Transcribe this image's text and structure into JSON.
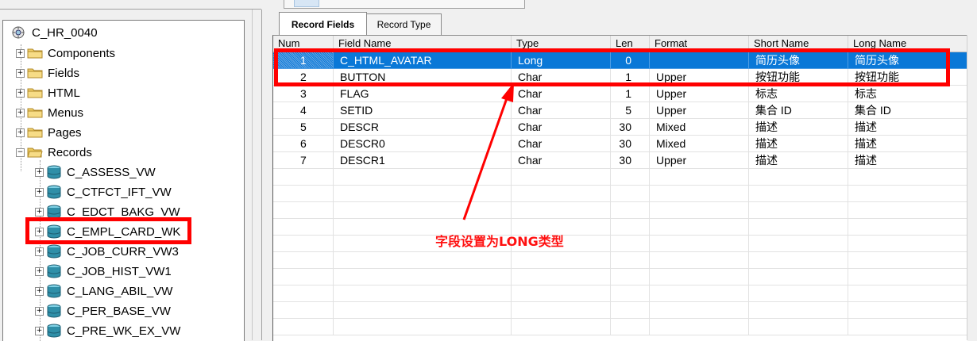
{
  "tree": {
    "root": "C_HR_0040",
    "folders": [
      {
        "label": "Components",
        "open": false
      },
      {
        "label": "Fields",
        "open": false
      },
      {
        "label": "HTML",
        "open": false
      },
      {
        "label": "Menus",
        "open": false
      },
      {
        "label": "Pages",
        "open": false
      },
      {
        "label": "Records",
        "open": true
      }
    ],
    "records": [
      "C_ASSESS_VW",
      "C_CTFCT_IFT_VW",
      "C_EDCT_BAKG_VW",
      "C_EMPL_CARD_WK",
      "C_JOB_CURR_VW3",
      "C_JOB_HIST_VW1",
      "C_LANG_ABIL_VW",
      "C_PER_BASE_VW",
      "C_PRE_WK_EX_VW"
    ],
    "expand_plus": "+",
    "expand_minus": "−"
  },
  "tabs": {
    "record_fields": "Record Fields",
    "record_type": "Record Type"
  },
  "grid": {
    "columns": [
      "Num",
      "Field Name",
      "Type",
      "Len",
      "Format",
      "Short Name",
      "Long Name"
    ],
    "rows": [
      {
        "num": "1",
        "field": "C_HTML_AVATAR",
        "type": "Long",
        "len": "0",
        "format": "",
        "short": "简历头像",
        "long": "简历头像",
        "selected": true
      },
      {
        "num": "2",
        "field": "BUTTON",
        "type": "Char",
        "len": "1",
        "format": "Upper",
        "short": "按钮功能",
        "long": "按钮功能"
      },
      {
        "num": "3",
        "field": "FLAG",
        "type": "Char",
        "len": "1",
        "format": "Upper",
        "short": "标志",
        "long": "标志"
      },
      {
        "num": "4",
        "field": "SETID",
        "type": "Char",
        "len": "5",
        "format": "Upper",
        "short": "集合 ID",
        "long": "集合 ID"
      },
      {
        "num": "5",
        "field": "DESCR",
        "type": "Char",
        "len": "30",
        "format": "Mixed",
        "short": "描述",
        "long": "描述"
      },
      {
        "num": "6",
        "field": "DESCR0",
        "type": "Char",
        "len": "30",
        "format": "Mixed",
        "short": "描述",
        "long": "描述"
      },
      {
        "num": "7",
        "field": "DESCR1",
        "type": "Char",
        "len": "30",
        "format": "Upper",
        "short": "描述",
        "long": "描述"
      }
    ]
  },
  "annotation": {
    "note": "字段设置为LONG类型",
    "color": "#ff0000"
  },
  "colors": {
    "selection": "#0a78d7",
    "folder": "#f2d06b",
    "database": "#2f8fa8"
  }
}
